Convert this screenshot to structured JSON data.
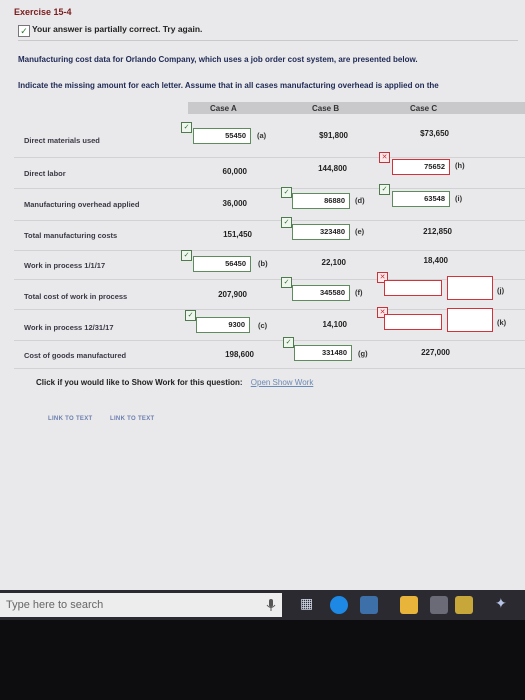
{
  "exercise_title": "Exercise 15-4",
  "status_message": "Your answer is partially correct.  Try again.",
  "intro_line1": "Manufacturing cost data for Orlando Company, which uses a job order cost system, are presented below.",
  "intro_line2": "Indicate the missing amount for each letter. Assume that in all cases manufacturing overhead is applied on the",
  "columns": {
    "a": "Case A",
    "b": "Case B",
    "c": "Case C"
  },
  "rows": {
    "dm": {
      "label": "Direct materials used",
      "a": "55450",
      "a_letter": "(a)",
      "b": "$91,800",
      "c": "$73,650"
    },
    "dl": {
      "label": "Direct labor",
      "a": "60,000",
      "b": "144,800",
      "c": "75652",
      "c_letter": "(h)"
    },
    "moh": {
      "label": "Manufacturing overhead applied",
      "a": "36,000",
      "b": "86880",
      "b_letter": "(d)",
      "c": "63548",
      "c_letter": "(i)"
    },
    "tmc": {
      "label": "Total manufacturing costs",
      "a": "151,450",
      "b": "323480",
      "b_letter": "(e)",
      "c": "212,850"
    },
    "wip1": {
      "label": "Work in process 1/1/17",
      "a": "56450",
      "a_letter": "(b)",
      "b": "22,100",
      "c": "18,400"
    },
    "tcw": {
      "label": "Total cost of work in process",
      "a": "207,900",
      "b": "345580",
      "b_letter": "(f)",
      "c": "",
      "c_letter": "(j)"
    },
    "wip2": {
      "label": "Work in process 12/31/17",
      "a": "9300",
      "a_letter": "(c)",
      "b": "14,100",
      "c": "",
      "c_letter": "(k)"
    },
    "cogm": {
      "label": "Cost of goods manufactured",
      "a": "198,600",
      "b": "331480",
      "b_letter": "(g)",
      "c": "227,000"
    }
  },
  "show_work_prompt": "Click if you would like to Show Work for this question:",
  "show_work_link": "Open Show Work",
  "link_to_text_1": "LINK TO TEXT",
  "link_to_text_2": "LINK TO TEXT",
  "taskbar_search_placeholder": "Type here to search",
  "colors": {
    "wrong": "#d2323a",
    "right": "#5e8c5e",
    "title": "#7a1d1d"
  }
}
